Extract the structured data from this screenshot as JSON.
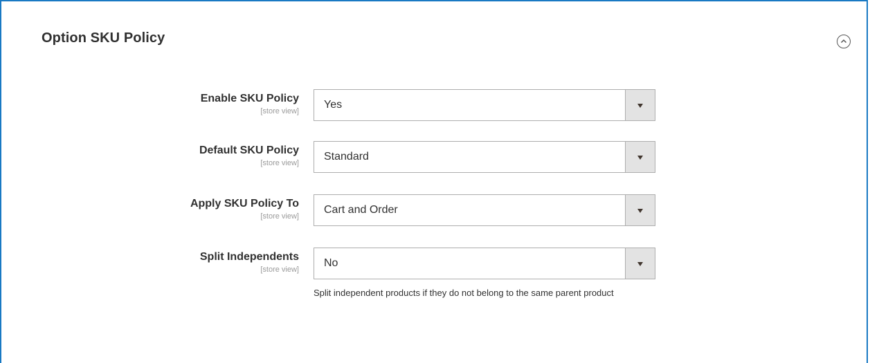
{
  "section": {
    "title": "Option SKU Policy",
    "toggle_icon": "chevron-up-circle-icon"
  },
  "fields": [
    {
      "label": "Enable SKU Policy",
      "scope": "[store view]",
      "value": "Yes"
    },
    {
      "label": "Default SKU Policy",
      "scope": "[store view]",
      "value": "Standard"
    },
    {
      "label": "Apply SKU Policy To",
      "scope": "[store view]",
      "value": "Cart and Order"
    },
    {
      "label": "Split Independents",
      "scope": "[store view]",
      "value": "No",
      "note": "Split independent products if they do not belong to the same parent product"
    }
  ],
  "colors": {
    "border_accent": "#1979c3",
    "select_arrow_bg": "#e3e3e3",
    "scope_text": "#999999"
  }
}
